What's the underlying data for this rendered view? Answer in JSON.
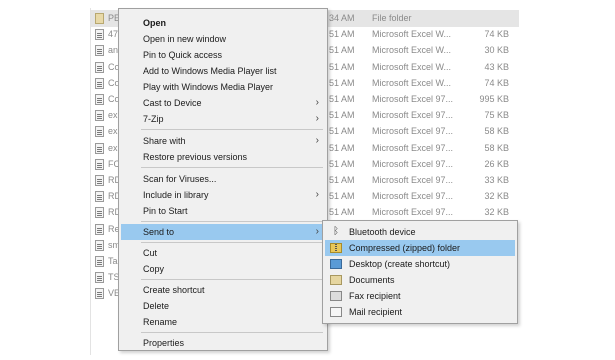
{
  "file_list": {
    "rows": [
      {
        "name": "PE",
        "modified": "34 AM",
        "type": "File folder",
        "size": "",
        "icon": "folder-icon"
      },
      {
        "name": "47",
        "modified": "51 AM",
        "type": "Microsoft Excel W...",
        "size": "74 KB",
        "icon": "excel-file-icon"
      },
      {
        "name": "an",
        "modified": "51 AM",
        "type": "Microsoft Excel W...",
        "size": "30 KB",
        "icon": "excel-file-icon"
      },
      {
        "name": "Co",
        "modified": "51 AM",
        "type": "Microsoft Excel W...",
        "size": "43 KB",
        "icon": "excel-file-icon"
      },
      {
        "name": "Co",
        "modified": "51 AM",
        "type": "Microsoft Excel W...",
        "size": "74 KB",
        "icon": "excel-file-icon"
      },
      {
        "name": "Co",
        "modified": "51 AM",
        "type": "Microsoft Excel 97...",
        "size": "995 KB",
        "icon": "excel-97-file-icon"
      },
      {
        "name": "ex",
        "modified": "51 AM",
        "type": "Microsoft Excel 97...",
        "size": "75 KB",
        "icon": "excel-97-file-icon"
      },
      {
        "name": "ex",
        "modified": "51 AM",
        "type": "Microsoft Excel 97...",
        "size": "58 KB",
        "icon": "excel-97-file-icon"
      },
      {
        "name": "ex",
        "modified": "51 AM",
        "type": "Microsoft Excel 97...",
        "size": "58 KB",
        "icon": "excel-97-file-icon"
      },
      {
        "name": "FC",
        "modified": "51 AM",
        "type": "Microsoft Excel 97...",
        "size": "26 KB",
        "icon": "excel-97-file-icon"
      },
      {
        "name": "RD",
        "modified": "51 AM",
        "type": "Microsoft Excel 97...",
        "size": "33 KB",
        "icon": "excel-97-file-icon"
      },
      {
        "name": "RD",
        "modified": "51 AM",
        "type": "Microsoft Excel 97...",
        "size": "32 KB",
        "icon": "excel-97-file-icon"
      },
      {
        "name": "RD",
        "modified": "51 AM",
        "type": "Microsoft Excel 97...",
        "size": "32 KB",
        "icon": "excel-97-file-icon"
      },
      {
        "name": "Re",
        "modified": "",
        "type": "",
        "size": "",
        "icon": "excel-97-file-icon"
      },
      {
        "name": "sm",
        "modified": "",
        "type": "",
        "size": "",
        "icon": "excel-97-file-icon"
      },
      {
        "name": "Ta",
        "modified": "",
        "type": "",
        "size": "",
        "icon": "excel-97-file-icon"
      },
      {
        "name": "TS",
        "modified": "",
        "type": "",
        "size": "",
        "icon": "excel-97-file-icon"
      },
      {
        "name": "VE",
        "modified": "",
        "type": "",
        "size": "",
        "icon": "excel-97-file-icon"
      }
    ]
  },
  "context_menu": {
    "open": "Open",
    "open_new_window": "Open in new window",
    "pin_quick_access": "Pin to Quick access",
    "add_wmp_list": "Add to Windows Media Player list",
    "play_wmp": "Play with Windows Media Player",
    "cast_to_device": "Cast to Device",
    "seven_zip": "7-Zip",
    "share_with": "Share with",
    "restore_versions": "Restore previous versions",
    "scan_viruses": "Scan for Viruses...",
    "include_library": "Include in library",
    "pin_start": "Pin to Start",
    "send_to": "Send to",
    "cut": "Cut",
    "copy": "Copy",
    "create_shortcut": "Create shortcut",
    "delete": "Delete",
    "rename": "Rename",
    "properties": "Properties",
    "submenu_arrow": "›"
  },
  "send_to_menu": {
    "bluetooth": "Bluetooth device",
    "compressed": "Compressed (zipped) folder",
    "desktop": "Desktop (create shortcut)",
    "documents": "Documents",
    "fax": "Fax recipient",
    "mail": "Mail recipient",
    "bluetooth_glyph": "ᛒ"
  },
  "colors": {
    "highlight": "#99c9ef",
    "menu_background": "#f0f0f0",
    "selected_row": "#e5e5e5"
  }
}
